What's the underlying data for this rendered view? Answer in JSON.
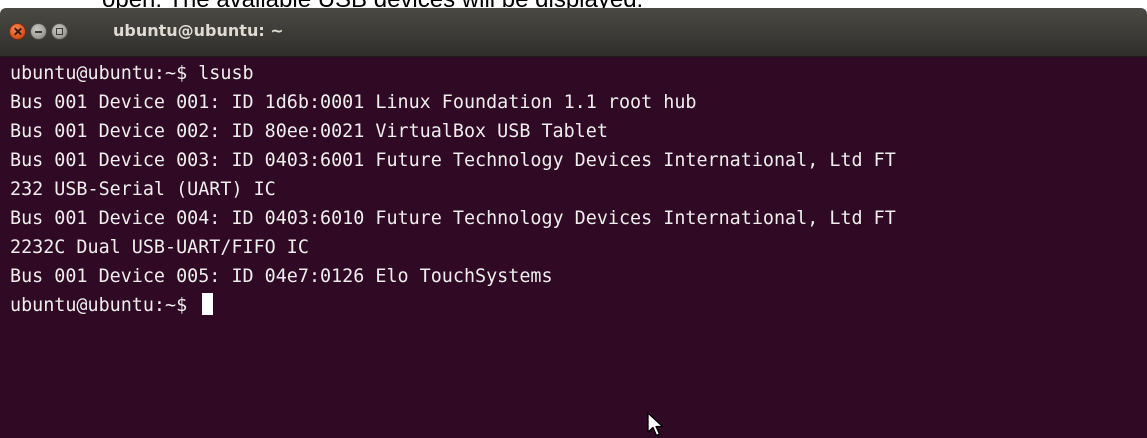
{
  "document": {
    "caption": "open. The available USB devices will be displayed."
  },
  "window": {
    "title": "ubuntu@ubuntu: ~",
    "buttons": [
      "close",
      "minimize",
      "maximize"
    ]
  },
  "terminal": {
    "lines": [
      "ubuntu@ubuntu:~$ lsusb",
      "Bus 001 Device 001: ID 1d6b:0001 Linux Foundation 1.1 root hub",
      "Bus 001 Device 002: ID 80ee:0021 VirtualBox USB Tablet",
      "Bus 001 Device 003: ID 0403:6001 Future Technology Devices International, Ltd FT",
      "232 USB-Serial (UART) IC",
      "Bus 001 Device 004: ID 0403:6010 Future Technology Devices International, Ltd FT",
      "2232C Dual USB-UART/FIFO IC",
      "Bus 001 Device 005: ID 04e7:0126 Elo TouchSystems"
    ],
    "prompt": "ubuntu@ubuntu:~$ "
  },
  "colors": {
    "terminal_background": "#300a24",
    "terminal_text": "#eeeeec",
    "titlebar": "#3c3b37",
    "close_button": "#e25a22"
  }
}
